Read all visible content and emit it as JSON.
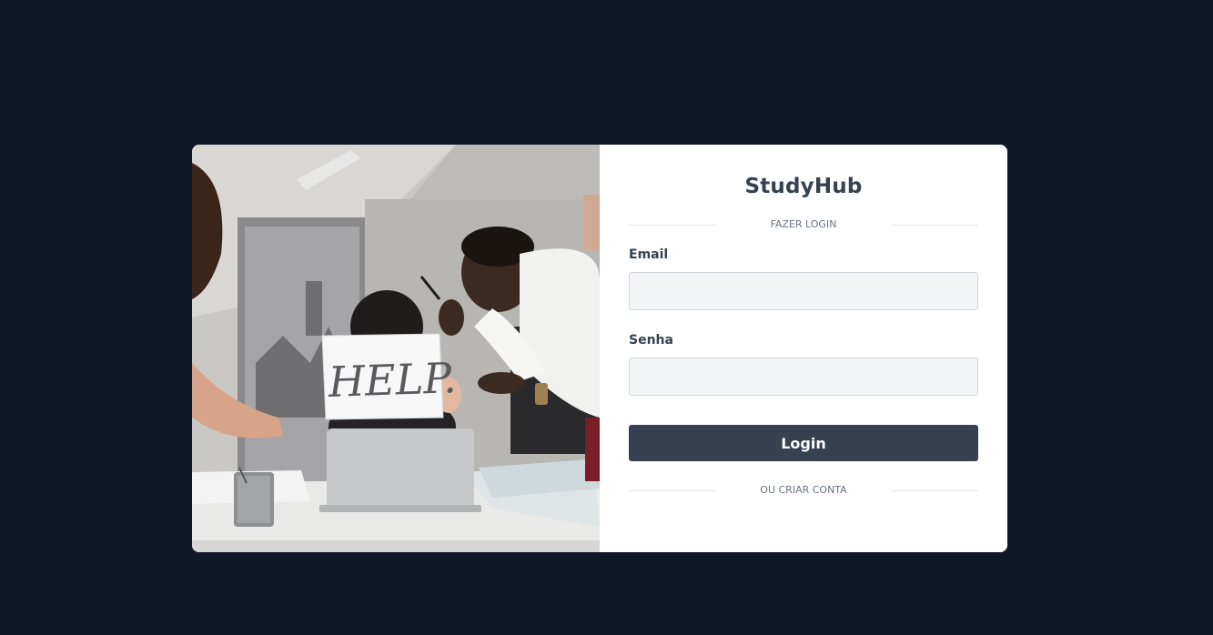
{
  "brand": {
    "title": "StudyHub"
  },
  "login": {
    "divider_label": "FAZER LOGIN",
    "email_label": "Email",
    "email_value": "",
    "password_label": "Senha",
    "password_value": "",
    "submit_label": "Login",
    "create_account_label": "OU CRIAR CONTA"
  },
  "image": {
    "sign_text": "HELP."
  },
  "colors": {
    "page_bg": "#111827",
    "button_bg": "#374151",
    "input_bg": "#f3f4f6"
  }
}
